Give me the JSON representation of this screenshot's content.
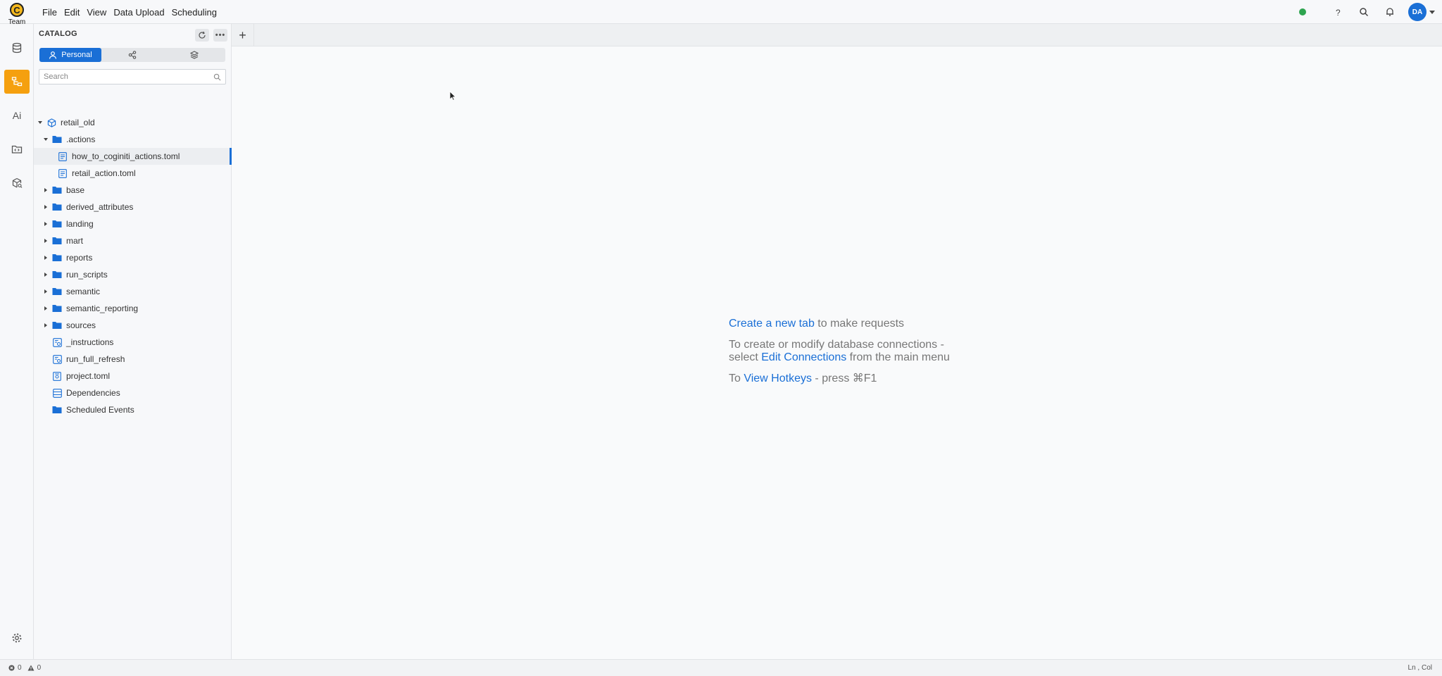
{
  "app": {
    "logo_letter": "C",
    "logo_label": "Team"
  },
  "menu": [
    "File",
    "Edit",
    "View",
    "Data Upload",
    "Scheduling"
  ],
  "user": {
    "initials": "DA",
    "status_color": "#2ea44f"
  },
  "catalog": {
    "header": "CATALOG",
    "tabs": {
      "personal_label": "Personal"
    },
    "search_placeholder": "Search",
    "tree": [
      {
        "label": "retail_old",
        "level": 0,
        "caret": "down",
        "icon": "package-icon"
      },
      {
        "label": ".actions",
        "level": 1,
        "caret": "down",
        "icon": "folder-icon"
      },
      {
        "label": "how_to_coginiti_actions.toml",
        "level": 2,
        "caret": "none",
        "icon": "file-icon",
        "selected": true
      },
      {
        "label": "retail_action.toml",
        "level": 2,
        "caret": "none",
        "icon": "file-icon"
      },
      {
        "label": "base",
        "level": 1,
        "caret": "right",
        "icon": "folder-icon"
      },
      {
        "label": "derived_attributes",
        "level": 1,
        "caret": "right",
        "icon": "folder-icon"
      },
      {
        "label": "landing",
        "level": 1,
        "caret": "right",
        "icon": "folder-icon"
      },
      {
        "label": "mart",
        "level": 1,
        "caret": "right",
        "icon": "folder-icon"
      },
      {
        "label": "reports",
        "level": 1,
        "caret": "right",
        "icon": "folder-icon"
      },
      {
        "label": "run_scripts",
        "level": 1,
        "caret": "right",
        "icon": "folder-icon"
      },
      {
        "label": "semantic",
        "level": 1,
        "caret": "right",
        "icon": "folder-icon"
      },
      {
        "label": "semantic_reporting",
        "level": 1,
        "caret": "right",
        "icon": "folder-icon"
      },
      {
        "label": "sources",
        "level": 1,
        "caret": "right",
        "icon": "folder-icon"
      },
      {
        "label": "_instructions",
        "level": 1,
        "caret": "none",
        "icon": "script-icon"
      },
      {
        "label": "run_full_refresh",
        "level": 1,
        "caret": "none",
        "icon": "script-icon"
      },
      {
        "label": "project.toml",
        "level": 1,
        "caret": "none",
        "icon": "config-file-icon"
      },
      {
        "label": "Dependencies",
        "level": 1,
        "caret": "none",
        "icon": "dependencies-icon"
      },
      {
        "label": "Scheduled Events",
        "level": 0,
        "caret": "none",
        "icon": "folder-icon"
      }
    ]
  },
  "welcome": {
    "create_link": "Create a new tab",
    "create_text": " to make requests",
    "conn_line1": "To create or modify database connections -",
    "conn_prefix": "select ",
    "conn_link": "Edit Connections",
    "conn_suffix": " from the main menu",
    "hotkeys_prefix": "To ",
    "hotkeys_link": "View Hotkeys",
    "hotkeys_suffix": " - press ⌘F1"
  },
  "statusbar": {
    "errors": "0",
    "warnings": "0",
    "position": "Ln , Col"
  },
  "colors": {
    "accent": "#1a6fd6",
    "rail_active": "#f5a00f"
  }
}
